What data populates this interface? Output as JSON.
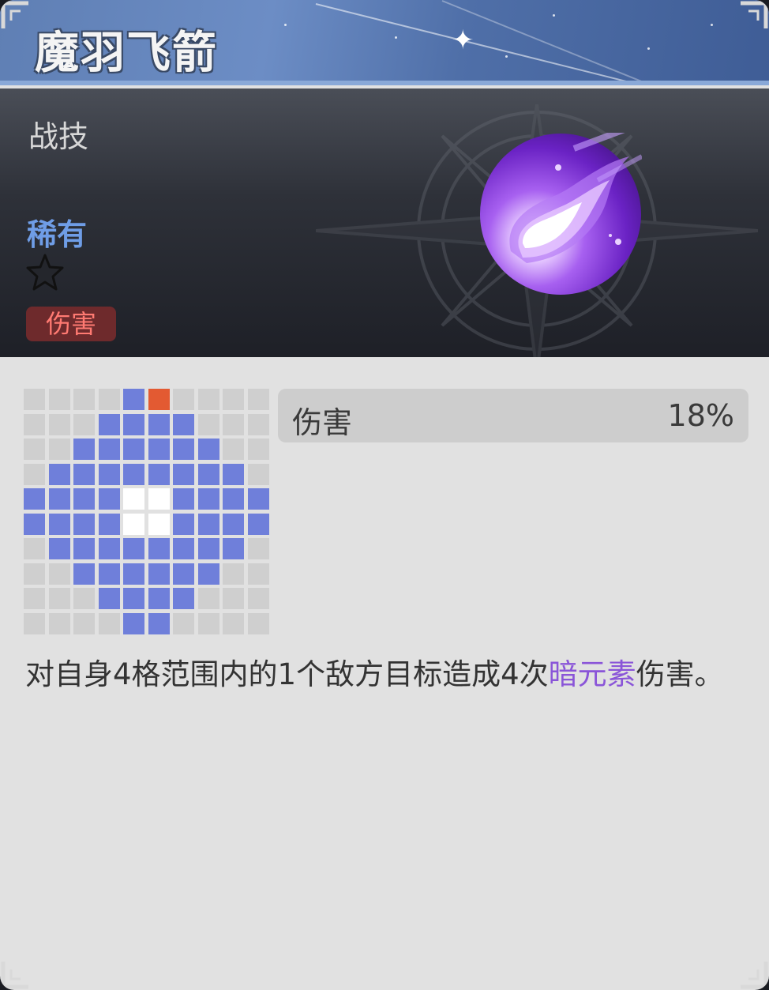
{
  "skill": {
    "name": "魔羽飞箭",
    "category": "战技",
    "rarity": "稀有",
    "stars": 1,
    "tag": "伤害",
    "icon": "dark-flame-orb-icon"
  },
  "stat": {
    "label": "伤害",
    "value": "18%"
  },
  "description": {
    "before": "对自身4格范围内的1个敌方目标造成4次",
    "highlight": "暗元素",
    "after": "伤害。"
  },
  "range_grid": [
    "eeeeaTeeee",
    "eeeaaaaeee",
    "eeaaaaaaee",
    "eaaaaaaaae",
    "aaaassaaaa",
    "aaaassaaaa",
    "eaaaaaaaae",
    "eeaaaaaaee",
    "eeeaaaaeee",
    "eeeeaaeeee"
  ],
  "colors": {
    "title_bar": "#6c8dc5",
    "rarity": "#6f9de6",
    "tag_bg": "#6e2a2c",
    "tag_text": "#ff7a72",
    "area_cell": "#6f7fda",
    "self_cell": "#ffffff",
    "target_cell": "#e35a32",
    "empty_cell": "#cfcfcf",
    "dark_element": "#8a55d8"
  }
}
